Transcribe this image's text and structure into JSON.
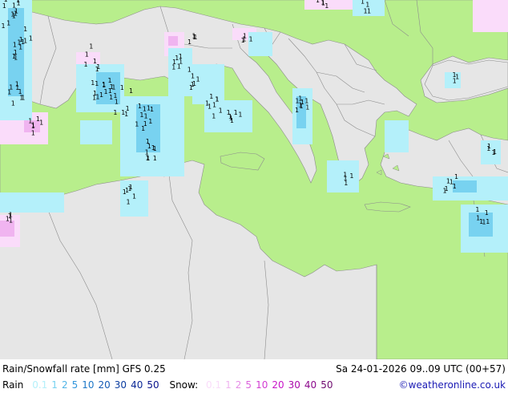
{
  "footer": {
    "title": "Rain/Snowfall rate [mm] GFS 0.25",
    "datetime": "Sa 24-01-2026 09..09 UTC (00+57)",
    "rain_label": "Rain",
    "rain_levels": [
      {
        "value": "0.1",
        "color": "#b4f0fa"
      },
      {
        "value": "1",
        "color": "#78d2f0"
      },
      {
        "value": "2",
        "color": "#50b4e6"
      },
      {
        "value": "5",
        "color": "#3296dc"
      },
      {
        "value": "10",
        "color": "#1e78c8"
      },
      {
        "value": "20",
        "color": "#145ab4"
      },
      {
        "value": "30",
        "color": "#0a3ca0"
      },
      {
        "value": "40",
        "color": "#0a2896"
      },
      {
        "value": "50",
        "color": "#0a148c"
      }
    ],
    "snow_label": "Snow:",
    "snow_levels": [
      {
        "value": "0.1",
        "color": "#fadcfa"
      },
      {
        "value": "1",
        "color": "#f0b4f0"
      },
      {
        "value": "2",
        "color": "#e68ce6"
      },
      {
        "value": "5",
        "color": "#dc64dc"
      },
      {
        "value": "10",
        "color": "#d23cd2"
      },
      {
        "value": "20",
        "color": "#c814c8"
      },
      {
        "value": "30",
        "color": "#aa0aaa"
      },
      {
        "value": "40",
        "color": "#8c0a8c"
      },
      {
        "value": "50",
        "color": "#6e0a6e"
      }
    ],
    "credit": "©weatheronline.co.uk"
  },
  "colors": {
    "land": "#b8ee8c",
    "sea": "#e6e6e6",
    "border": "#8c8c8c",
    "rain_light": "#b4f0fa",
    "rain_medium": "#78d2f0",
    "snow_light": "#fadcfa",
    "snow_medium": "#f0b4f0",
    "marker": "#000000"
  },
  "map": {
    "marker_text": "1"
  }
}
